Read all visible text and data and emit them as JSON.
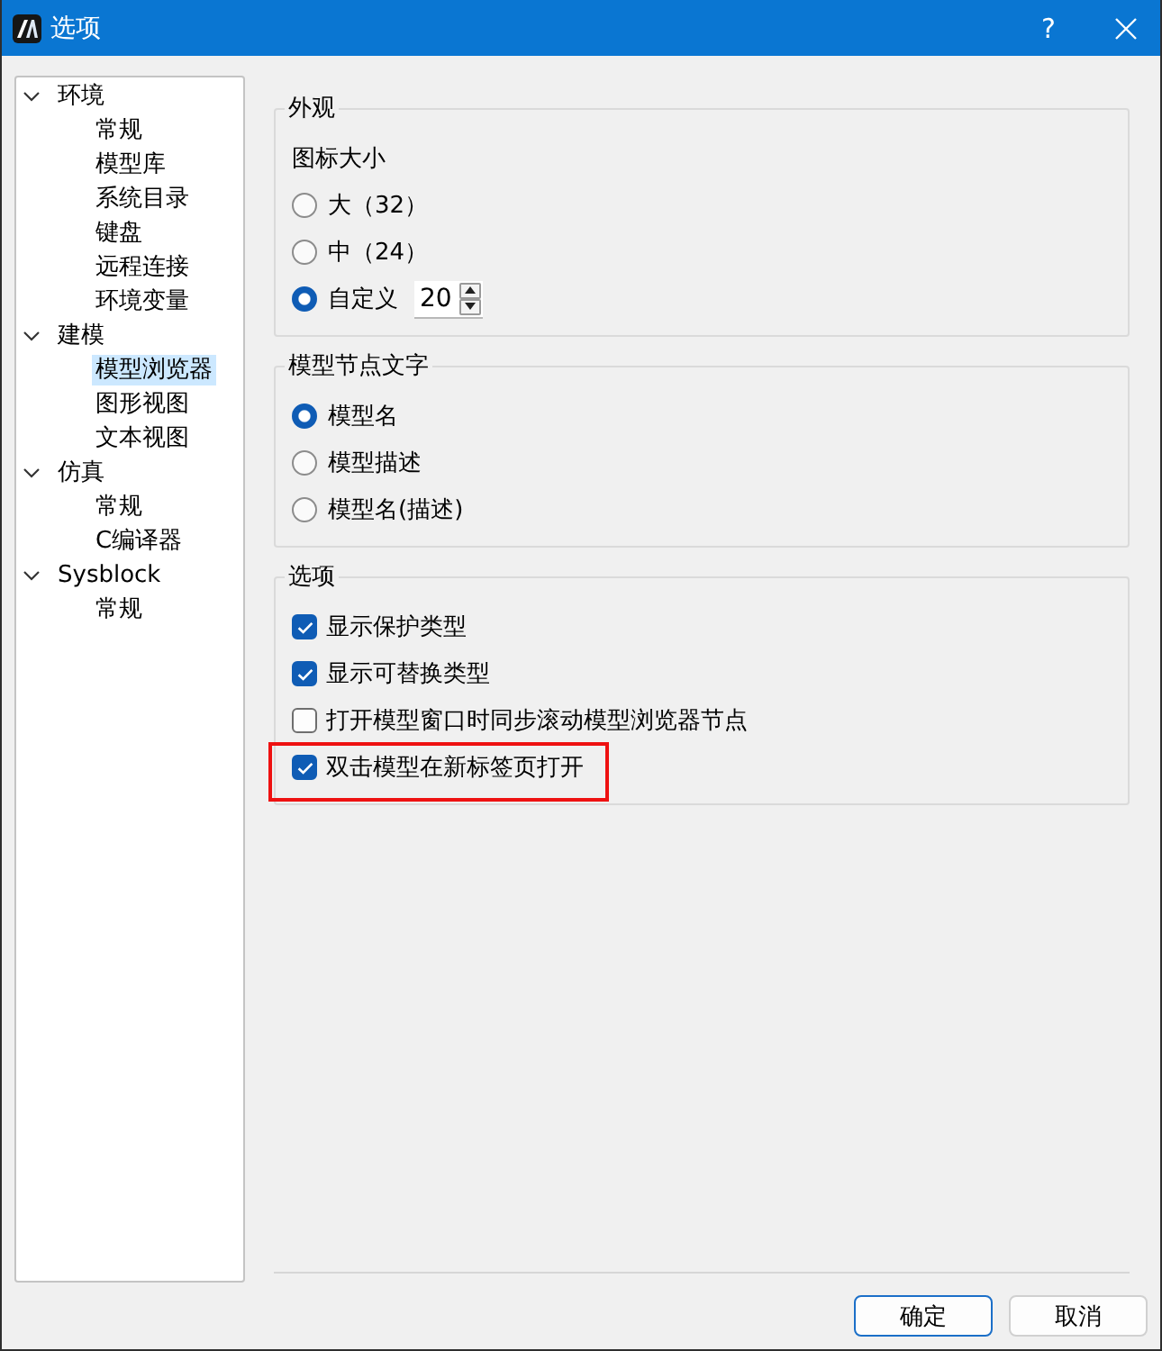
{
  "window": {
    "title": "选项",
    "help_button": "?"
  },
  "tree": [
    {
      "label": "环境",
      "expanded": true,
      "selected": false,
      "children": [
        {
          "label": "常规",
          "selected": false
        },
        {
          "label": "模型库",
          "selected": false
        },
        {
          "label": "系统目录",
          "selected": false
        },
        {
          "label": "键盘",
          "selected": false
        },
        {
          "label": "远程连接",
          "selected": false
        },
        {
          "label": "环境变量",
          "selected": false
        }
      ]
    },
    {
      "label": "建模",
      "expanded": true,
      "selected": false,
      "children": [
        {
          "label": "模型浏览器",
          "selected": true
        },
        {
          "label": "图形视图",
          "selected": false
        },
        {
          "label": "文本视图",
          "selected": false
        }
      ]
    },
    {
      "label": "仿真",
      "expanded": true,
      "selected": false,
      "children": [
        {
          "label": "常规",
          "selected": false
        },
        {
          "label": "C编译器",
          "selected": false
        }
      ]
    },
    {
      "label": "Sysblock",
      "expanded": true,
      "selected": false,
      "children": [
        {
          "label": "常规",
          "selected": false
        }
      ]
    }
  ],
  "groups": [
    {
      "title": "外观",
      "subtitle": "图标大小",
      "kind": "radio",
      "items": [
        {
          "label": "大（32）",
          "selected": false
        },
        {
          "label": "中（24）",
          "selected": false
        },
        {
          "label": "自定义",
          "selected": true,
          "spin_value": "20"
        }
      ]
    },
    {
      "title": "模型节点文字",
      "kind": "radio",
      "items": [
        {
          "label": "模型名",
          "selected": true
        },
        {
          "label": "模型描述",
          "selected": false
        },
        {
          "label": "模型名(描述)",
          "selected": false
        }
      ]
    },
    {
      "title": "选项",
      "kind": "checkbox",
      "items": [
        {
          "label": "显示保护类型",
          "checked": true,
          "highlighted": false
        },
        {
          "label": "显示可替换类型",
          "checked": true,
          "highlighted": false
        },
        {
          "label": "打开模型窗口时同步滚动模型浏览器节点",
          "checked": false,
          "highlighted": false
        },
        {
          "label": "双击模型在新标签页打开",
          "checked": true,
          "highlighted": true
        }
      ]
    }
  ],
  "buttons": [
    {
      "label": "确定",
      "default": true
    },
    {
      "label": "取消",
      "default": false
    }
  ]
}
